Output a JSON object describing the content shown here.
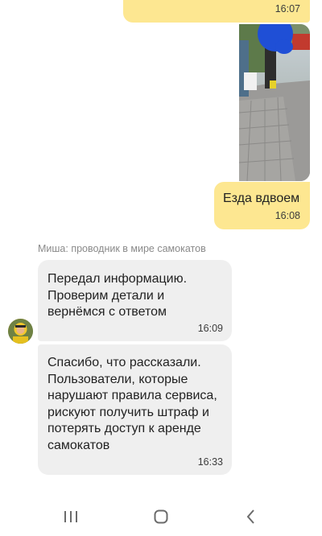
{
  "messages": [
    {
      "side": "out",
      "text": "",
      "time": "16:07"
    },
    {
      "side": "out",
      "type": "photo"
    },
    {
      "side": "out",
      "text": "Езда вдвоем",
      "time": "16:08"
    }
  ],
  "support": {
    "sender_name": "Миша: проводник в мире самокатов",
    "messages": [
      {
        "lines": [
          "Передал информацию.",
          "Проверим детали и",
          "вернёмся с ответом"
        ],
        "time": "16:09"
      },
      {
        "lines": [
          "Спасибо, что рассказали.",
          "Пользователи, которые",
          "нарушают правила сервиса,",
          "рискуют получить штраф и",
          "потерять доступ к аренде",
          "самокатов"
        ],
        "time": "16:33"
      }
    ]
  },
  "colors": {
    "outgoing_bubble": "#fde791",
    "incoming_bubble": "#efefef"
  },
  "icons": {
    "nav_recent": "recents-icon",
    "nav_home": "home-icon",
    "nav_back": "back-icon"
  }
}
